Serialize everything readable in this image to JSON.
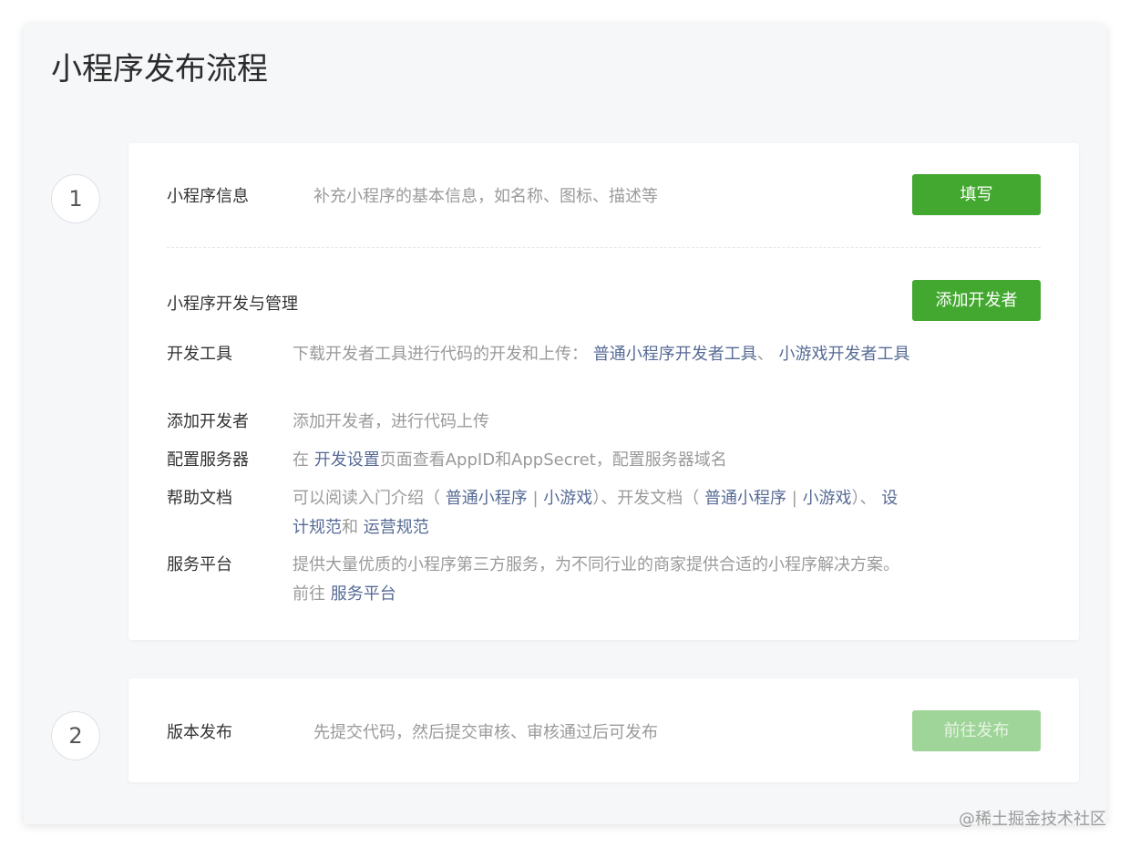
{
  "panel": {
    "title": "小程序发布流程"
  },
  "steps": [
    {
      "number": "1",
      "info": {
        "label": "小程序信息",
        "desc": "补充小程序的基本信息，如名称、图标、描述等",
        "button": "填写"
      },
      "dev": {
        "title": "小程序开发与管理",
        "button": "添加开发者",
        "rows": [
          {
            "label": "开发工具",
            "text_1": "下载开发者工具进行代码的开发和上传：",
            "link_1": "普通小程序开发者工具",
            "text_2": "、",
            "link_2": "小游戏开发者工具"
          },
          {
            "label": "添加开发者",
            "text_1": "添加开发者，进行代码上传"
          },
          {
            "label": "配置服务器",
            "text_1": "在",
            "link_1": "开发设置",
            "text_2": "页面查看AppID和AppSecret，配置服务器域名"
          },
          {
            "label": "帮助文档",
            "text_1": "可以阅读入门介绍（",
            "link_1": "普通小程序",
            "text_2": "|",
            "link_2": "小游戏",
            "text_3": "）、开发文档（",
            "link_3": "普通小程序",
            "text_4": "|",
            "link_4": "小游戏",
            "text_5": "）、",
            "link_5": "设计规范",
            "text_6": "和",
            "link_6": "运营规范"
          },
          {
            "label": "服务平台",
            "text_1": "提供大量优质的小程序第三方服务，为不同行业的商家提供合适的小程序解决方案。前往",
            "link_1": "服务平台"
          }
        ]
      }
    },
    {
      "number": "2",
      "info": {
        "label": "版本发布",
        "desc": "先提交代码，然后提交审核、审核通过后可发布",
        "button": "前往发布",
        "button_state": "disabled"
      }
    }
  ],
  "watermark": "@稀土掘金技术社区",
  "colors": {
    "accent_green": "#43a82f",
    "disabled_green": "#9fd598",
    "link_blue": "#576b95",
    "muted_text": "#9a9a9a",
    "panel_bg": "#f6f7f9"
  }
}
